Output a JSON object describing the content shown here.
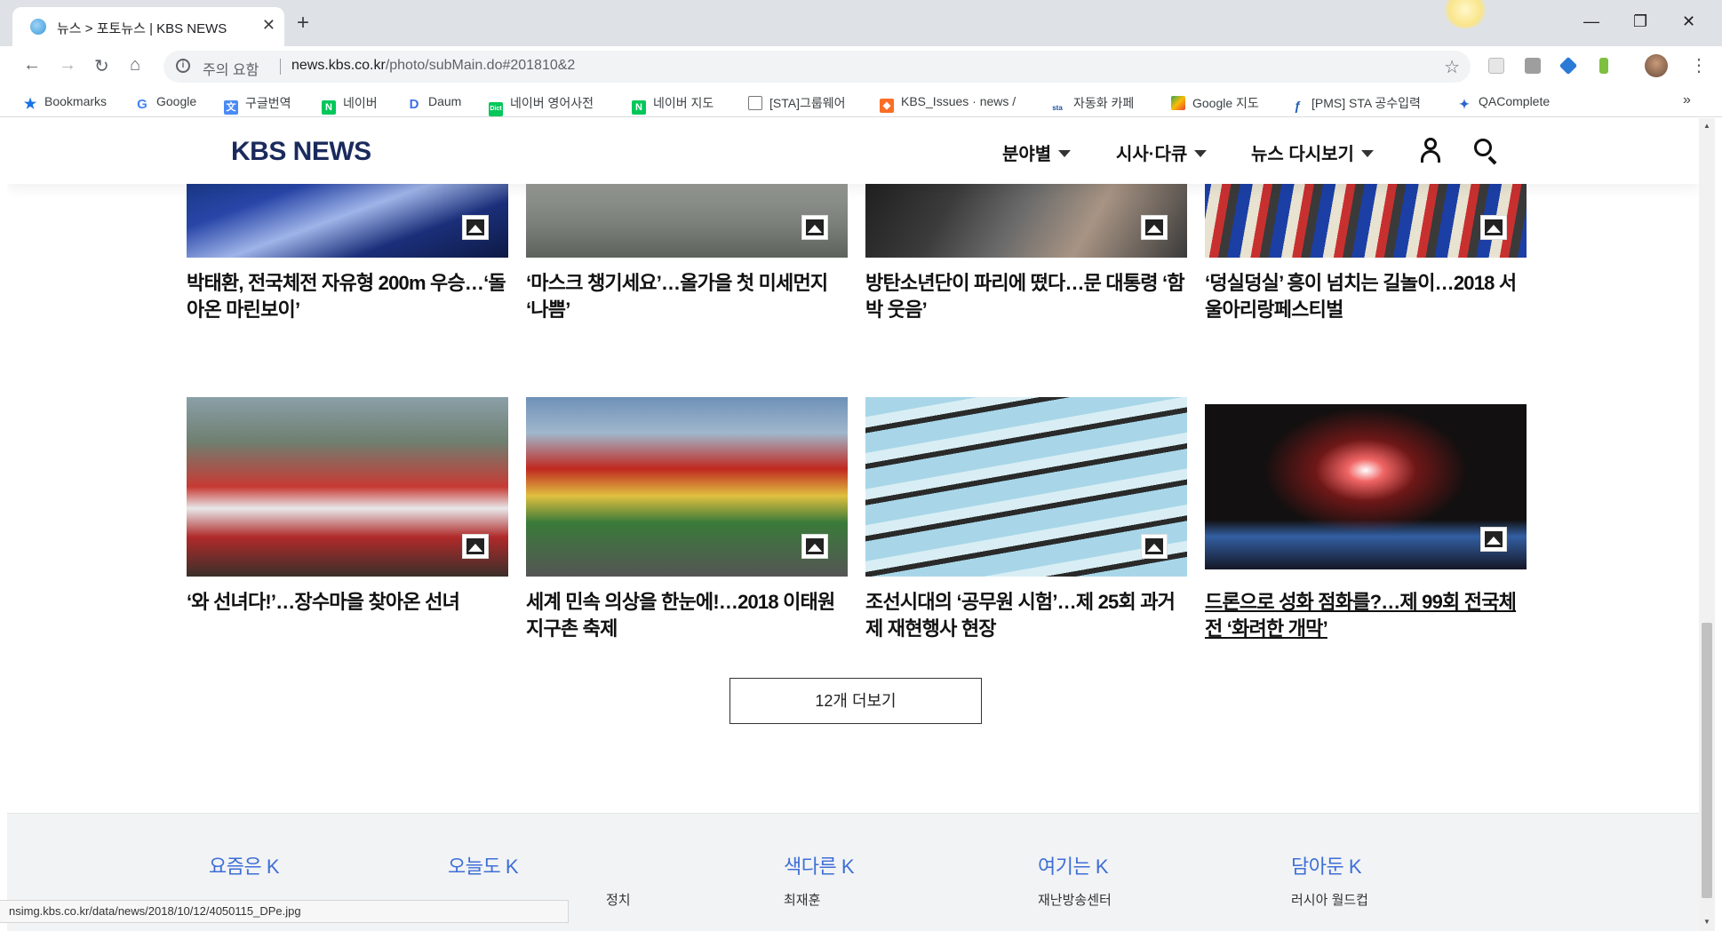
{
  "browser": {
    "tab_title": "뉴스 > 포토뉴스 | KBS NEWS",
    "address_warning": "주의 요함",
    "url_host": "news.kbs.co.kr",
    "url_path": "/photo/subMain.do#201810&2"
  },
  "bookmarks": [
    {
      "label": "Bookmarks",
      "icon": "star-icon"
    },
    {
      "label": "Google",
      "icon": "google-icon"
    },
    {
      "label": "구글번역",
      "icon": "google-translate-icon"
    },
    {
      "label": "네이버",
      "icon": "naver-icon"
    },
    {
      "label": "Daum",
      "icon": "daum-icon"
    },
    {
      "label": "네이버 영어사전",
      "icon": "naver-dict-icon"
    },
    {
      "label": "네이버 지도",
      "icon": "naver-icon"
    },
    {
      "label": "[STA]그룹웨어",
      "icon": "page-icon"
    },
    {
      "label": "KBS_Issues · news / ",
      "icon": "gitlab-icon"
    },
    {
      "label": "자동화 카페",
      "icon": "sta-icon"
    },
    {
      "label": "Google 지도",
      "icon": "google-maps-icon"
    },
    {
      "label": "[PMS] STA 공수입력",
      "icon": "pms-icon"
    },
    {
      "label": "QAComplete",
      "icon": "qacomplete-icon"
    }
  ],
  "kbs": {
    "logo": "KBS NEWS",
    "menu": [
      "분야별",
      "시사·다큐",
      "뉴스 다시보기"
    ]
  },
  "cards": [
    {
      "caption": "박태환, 전국체전 자유형 200m 우승…‘돌아온 마린보이’"
    },
    {
      "caption": "‘마스크 챙기세요’…올가을 첫 미세먼지 ‘나쁨’"
    },
    {
      "caption": "방탄소년단이 파리에 떴다…문 대통령 ‘함박 웃음’"
    },
    {
      "caption": "‘덩실덩실’ 흥이 넘치는 길놀이…2018 서울아리랑페스티벌"
    },
    {
      "caption": "‘와 선녀다!’…장수마을 찾아온 선녀"
    },
    {
      "caption": "세계 민속 의상을 한눈에!…2018 이태원 지구촌 축제"
    },
    {
      "caption": "조선시대의 ‘공무원 시험’…제 25회 과거제 재현행사 현장"
    },
    {
      "caption": "드론으로 성화 점화를?…제 99회 전국체전 ‘화려한 개막’"
    }
  ],
  "more_button": "12개 더보기",
  "footer": {
    "headings": [
      "요즘은 K",
      "오늘도 K",
      "색다른 K",
      "여기는 K",
      "담아둔 K"
    ],
    "subs": [
      "정치",
      "최재훈",
      "재난방송센터",
      "러시아 월드컵"
    ]
  },
  "status_url": "nsimg.kbs.co.kr/data/news/2018/10/12/4050115_DPe.jpg"
}
